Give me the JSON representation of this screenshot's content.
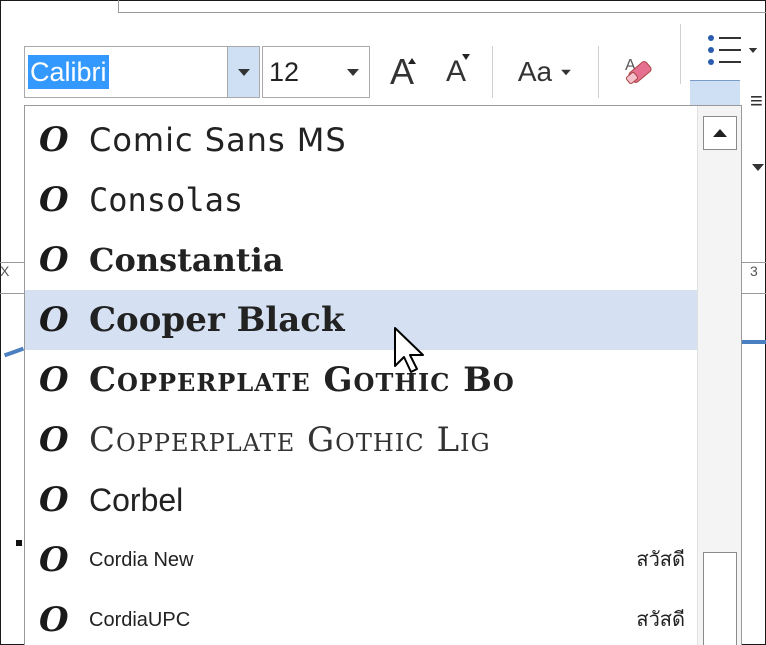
{
  "toolbar": {
    "font_name": "Calibri",
    "font_size": "12",
    "grow_label": "A",
    "shrink_label": "A",
    "change_case_label": "Aa",
    "colors": {
      "selection": "#3399ff",
      "arrow_bg": "#cfe0f4",
      "highlight": "#d5e1f2"
    }
  },
  "font_list": {
    "items": [
      {
        "name": "Comic Sans MS",
        "preview": ""
      },
      {
        "name": "Consolas",
        "preview": ""
      },
      {
        "name": "Constantia",
        "preview": ""
      },
      {
        "name": "Cooper Black",
        "preview": "",
        "selected": true
      },
      {
        "name": "Copperplate Gothic Bo",
        "preview": ""
      },
      {
        "name": "Copperplate Gothic Lig",
        "preview": ""
      },
      {
        "name": "Corbel",
        "preview": ""
      },
      {
        "name": "Cordia New",
        "preview": "สวัสดี"
      },
      {
        "name": "CordiaUPC",
        "preview": "สวัสดี"
      }
    ],
    "icon": "opentype-font-icon"
  },
  "background": {
    "ruler_left_glyph": "X",
    "ruler_right_glyph": "3"
  }
}
